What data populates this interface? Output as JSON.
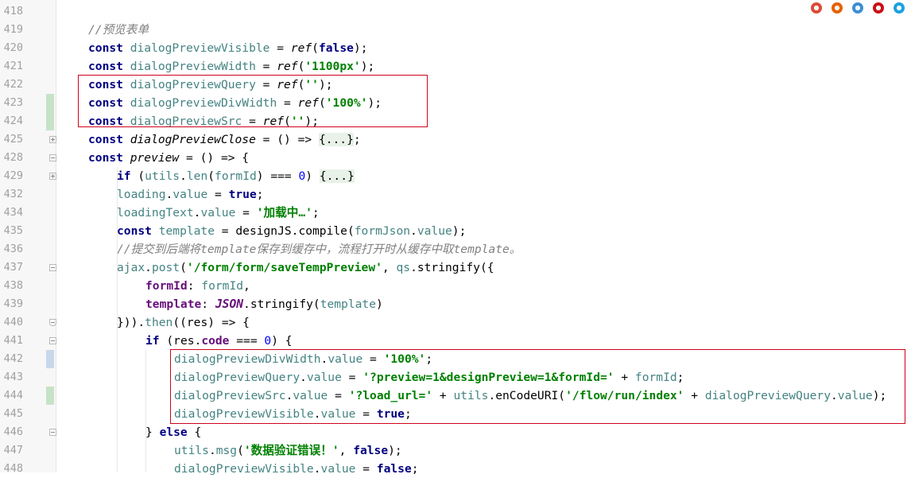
{
  "browser_icons": [
    {
      "name": "chrome-icon",
      "color": "#dd4b39"
    },
    {
      "name": "firefox-icon",
      "color": "#e66000"
    },
    {
      "name": "safari-icon",
      "color": "#3b8fd6"
    },
    {
      "name": "opera-icon",
      "color": "#cc0f16"
    },
    {
      "name": "ie-icon",
      "color": "#1ba1e2"
    }
  ],
  "colors": {
    "highlight_box": "#d0021b",
    "gutter_change_green": "#c7e3c7",
    "gutter_change_blue": "#c7d8ea"
  },
  "lines": [
    {
      "n": "418",
      "fold": "",
      "mark": "",
      "indent": 0,
      "tokens": []
    },
    {
      "n": "419",
      "fold": "",
      "mark": "",
      "indent": 1,
      "tokens": [
        [
          "cmt",
          "//预览表单"
        ]
      ]
    },
    {
      "n": "420",
      "fold": "",
      "mark": "",
      "indent": 1,
      "tokens": [
        [
          "kw",
          "const "
        ],
        [
          "var",
          "dialogPreviewVisible"
        ],
        [
          "def",
          " = "
        ],
        [
          "fn",
          "ref"
        ],
        [
          "def",
          "("
        ],
        [
          "kw",
          "false"
        ],
        [
          "def",
          ");"
        ]
      ]
    },
    {
      "n": "421",
      "fold": "",
      "mark": "",
      "indent": 1,
      "tokens": [
        [
          "kw",
          "const "
        ],
        [
          "var",
          "dialogPreviewWidth"
        ],
        [
          "def",
          " = "
        ],
        [
          "fn",
          "ref"
        ],
        [
          "def",
          "("
        ],
        [
          "str",
          "'1100px'"
        ],
        [
          "def",
          ");"
        ]
      ]
    },
    {
      "n": "422",
      "fold": "",
      "mark": "",
      "indent": 1,
      "tokens": [
        [
          "kw",
          "const "
        ],
        [
          "var",
          "dialogPreviewQuery"
        ],
        [
          "def",
          " = "
        ],
        [
          "fn",
          "ref"
        ],
        [
          "def",
          "("
        ],
        [
          "str",
          "''"
        ],
        [
          "def",
          ");"
        ]
      ]
    },
    {
      "n": "423",
      "fold": "",
      "mark": "green",
      "indent": 1,
      "tokens": [
        [
          "kw",
          "const "
        ],
        [
          "var",
          "dialogPreviewDivWidth"
        ],
        [
          "def",
          " = "
        ],
        [
          "fn",
          "ref"
        ],
        [
          "def",
          "("
        ],
        [
          "str",
          "'100%'"
        ],
        [
          "def",
          ");"
        ]
      ]
    },
    {
      "n": "424",
      "fold": "",
      "mark": "green",
      "indent": 1,
      "tokens": [
        [
          "kw",
          "const "
        ],
        [
          "var",
          "dialogPreviewSrc"
        ],
        [
          "def",
          " = "
        ],
        [
          "fn",
          "ref"
        ],
        [
          "def",
          "("
        ],
        [
          "str",
          "''"
        ],
        [
          "def",
          ");"
        ]
      ]
    },
    {
      "n": "425",
      "fold": "plus",
      "mark": "",
      "indent": 1,
      "tokens": [
        [
          "kw",
          "const "
        ],
        [
          "fn",
          "dialogPreviewClose"
        ],
        [
          "def",
          " = () => "
        ],
        [
          "fold-txt",
          "{...}"
        ],
        [
          "def",
          ";"
        ]
      ]
    },
    {
      "n": "428",
      "fold": "minus",
      "mark": "",
      "indent": 1,
      "tokens": [
        [
          "kw",
          "const "
        ],
        [
          "fn",
          "preview"
        ],
        [
          "def",
          " = () => {"
        ]
      ]
    },
    {
      "n": "429",
      "fold": "plus",
      "mark": "",
      "indent": 2,
      "tokens": [
        [
          "kw",
          "if "
        ],
        [
          "def",
          "("
        ],
        [
          "var",
          "utils"
        ],
        [
          "def",
          "."
        ],
        [
          "var",
          "len"
        ],
        [
          "def",
          "("
        ],
        [
          "var",
          "formId"
        ],
        [
          "def",
          ") === "
        ],
        [
          "num",
          "0"
        ],
        [
          "def",
          ") "
        ],
        [
          "fold-txt",
          "{...}"
        ]
      ]
    },
    {
      "n": "432",
      "fold": "",
      "mark": "",
      "indent": 2,
      "tokens": [
        [
          "var",
          "loading"
        ],
        [
          "def",
          "."
        ],
        [
          "var",
          "value"
        ],
        [
          "def",
          " = "
        ],
        [
          "kw",
          "true"
        ],
        [
          "def",
          ";"
        ]
      ]
    },
    {
      "n": "434",
      "fold": "",
      "mark": "",
      "indent": 2,
      "tokens": [
        [
          "var",
          "loadingText"
        ],
        [
          "def",
          "."
        ],
        [
          "var",
          "value"
        ],
        [
          "def",
          " = "
        ],
        [
          "str",
          "'加载中…'"
        ],
        [
          "def",
          ";"
        ]
      ]
    },
    {
      "n": "435",
      "fold": "",
      "mark": "",
      "indent": 2,
      "tokens": [
        [
          "kw",
          "const "
        ],
        [
          "var",
          "template"
        ],
        [
          "def",
          " = designJS."
        ],
        [
          "def",
          "compile("
        ],
        [
          "var",
          "formJson"
        ],
        [
          "def",
          "."
        ],
        [
          "var",
          "value"
        ],
        [
          "def",
          ");"
        ]
      ]
    },
    {
      "n": "436",
      "fold": "",
      "mark": "",
      "indent": 2,
      "tokens": [
        [
          "cmt",
          "//提交到后端将template保存到缓存中，流程打开时从缓存中取template。"
        ]
      ]
    },
    {
      "n": "437",
      "fold": "minus",
      "mark": "",
      "indent": 2,
      "tokens": [
        [
          "var",
          "ajax"
        ],
        [
          "def",
          "."
        ],
        [
          "var",
          "post"
        ],
        [
          "def",
          "("
        ],
        [
          "str",
          "'/form/form/saveTempPreview'"
        ],
        [
          "def",
          ", "
        ],
        [
          "var",
          "qs"
        ],
        [
          "def",
          ".stringify({"
        ]
      ]
    },
    {
      "n": "438",
      "fold": "",
      "mark": "",
      "indent": 3,
      "tokens": [
        [
          "prop",
          "formId"
        ],
        [
          "def",
          ": "
        ],
        [
          "var",
          "formId"
        ],
        [
          "def",
          ","
        ]
      ]
    },
    {
      "n": "439",
      "fold": "",
      "mark": "",
      "indent": 3,
      "tokens": [
        [
          "prop",
          "template"
        ],
        [
          "def",
          ": "
        ],
        [
          "ital",
          "JSON"
        ],
        [
          "def",
          "."
        ],
        [
          "def",
          "stringify("
        ],
        [
          "var",
          "template"
        ],
        [
          "def",
          ")"
        ]
      ]
    },
    {
      "n": "440",
      "fold": "end",
      "mark": "",
      "indent": 2,
      "tokens": [
        [
          "def",
          "}))."
        ],
        [
          "var",
          "then"
        ],
        [
          "def",
          "(("
        ],
        [
          "def",
          "res"
        ],
        [
          "def",
          ") => {"
        ]
      ]
    },
    {
      "n": "441",
      "fold": "minus",
      "mark": "",
      "indent": 3,
      "tokens": [
        [
          "kw",
          "if "
        ],
        [
          "def",
          "("
        ],
        [
          "def",
          "res"
        ],
        [
          "def",
          "."
        ],
        [
          "prop",
          "code"
        ],
        [
          "def",
          " === "
        ],
        [
          "num",
          "0"
        ],
        [
          "def",
          ") {"
        ]
      ]
    },
    {
      "n": "442",
      "fold": "",
      "mark": "blue",
      "indent": 4,
      "tokens": [
        [
          "var",
          "dialogPreviewDivWidth"
        ],
        [
          "def",
          "."
        ],
        [
          "var",
          "value"
        ],
        [
          "def",
          " = "
        ],
        [
          "str",
          "'100%'"
        ],
        [
          "def",
          ";"
        ]
      ]
    },
    {
      "n": "443",
      "fold": "",
      "mark": "",
      "indent": 4,
      "tokens": [
        [
          "var",
          "dialogPreviewQuery"
        ],
        [
          "def",
          "."
        ],
        [
          "var",
          "value"
        ],
        [
          "def",
          " = "
        ],
        [
          "str",
          "'?preview=1&designPreview=1&formId='"
        ],
        [
          "def",
          " + "
        ],
        [
          "var",
          "formId"
        ],
        [
          "def",
          ";"
        ]
      ]
    },
    {
      "n": "444",
      "fold": "",
      "mark": "green",
      "indent": 4,
      "tokens": [
        [
          "var",
          "dialogPreviewSrc"
        ],
        [
          "def",
          "."
        ],
        [
          "var",
          "value"
        ],
        [
          "def",
          " = "
        ],
        [
          "str",
          "'?load_url='"
        ],
        [
          "def",
          " + "
        ],
        [
          "var",
          "utils"
        ],
        [
          "def",
          "."
        ],
        [
          "def",
          "enCodeURI("
        ],
        [
          "str",
          "'/flow/run/index'"
        ],
        [
          "def",
          " + "
        ],
        [
          "var",
          "dialogPreviewQuery"
        ],
        [
          "def",
          "."
        ],
        [
          "var",
          "value"
        ],
        [
          "def",
          ");"
        ]
      ]
    },
    {
      "n": "445",
      "fold": "",
      "mark": "",
      "indent": 4,
      "tokens": [
        [
          "var",
          "dialogPreviewVisible"
        ],
        [
          "def",
          "."
        ],
        [
          "var",
          "value"
        ],
        [
          "def",
          " = "
        ],
        [
          "kw",
          "true"
        ],
        [
          "def",
          ";"
        ]
      ]
    },
    {
      "n": "446",
      "fold": "minus",
      "mark": "",
      "indent": 3,
      "tokens": [
        [
          "def",
          "} "
        ],
        [
          "kw",
          "else"
        ],
        [
          "def",
          " {"
        ]
      ]
    },
    {
      "n": "447",
      "fold": "",
      "mark": "",
      "indent": 4,
      "tokens": [
        [
          "var",
          "utils"
        ],
        [
          "def",
          "."
        ],
        [
          "var",
          "msg"
        ],
        [
          "def",
          "("
        ],
        [
          "str",
          "'数据验证错误！'"
        ],
        [
          "def",
          ", "
        ],
        [
          "kw",
          "false"
        ],
        [
          "def",
          ");"
        ]
      ]
    },
    {
      "n": "448",
      "fold": "",
      "mark": "",
      "indent": 4,
      "tokens": [
        [
          "var",
          "dialogPreviewVisible"
        ],
        [
          "def",
          "."
        ],
        [
          "var",
          "value"
        ],
        [
          "def",
          " = "
        ],
        [
          "kw",
          "false"
        ],
        [
          "def",
          ";"
        ]
      ]
    }
  ]
}
